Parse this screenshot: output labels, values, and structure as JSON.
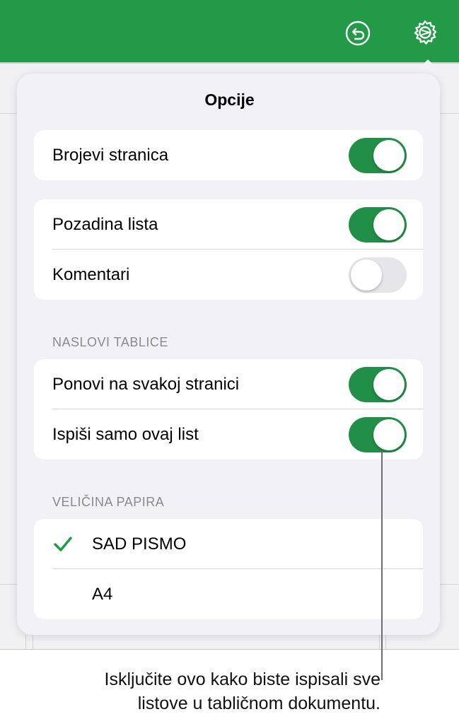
{
  "popover": {
    "title": "Opcije"
  },
  "groups": {
    "page_numbers": {
      "label": "Brojevi stranica",
      "on": true
    },
    "sheet_background": {
      "label": "Pozadina lista",
      "on": true
    },
    "comments": {
      "label": "Komentari",
      "on": false
    }
  },
  "table_headers": {
    "section_title": "NASLOVI TABLICE",
    "repeat_each_page": {
      "label": "Ponovi na svakoj stranici",
      "on": true
    },
    "print_this_sheet_only": {
      "label": "Ispiši samo ovaj list",
      "on": true
    }
  },
  "paper_size": {
    "section_title": "VELIČINA PAPIRA",
    "options": [
      {
        "label": "SAD PISMO",
        "selected": true
      },
      {
        "label": "A4",
        "selected": false
      }
    ]
  },
  "callout": {
    "line1": "Isključite ovo kako biste ispisali sve",
    "line2": "listove u tabličnom dokumentu."
  },
  "colors": {
    "toolbar": "#239a47",
    "toggle_on": "#218f47",
    "checkmark": "#1f9a4a"
  },
  "icons": {
    "toolbar_left": "undo-icon",
    "toolbar_right": "settings-icon",
    "selected_marker": "checkmark-icon"
  }
}
